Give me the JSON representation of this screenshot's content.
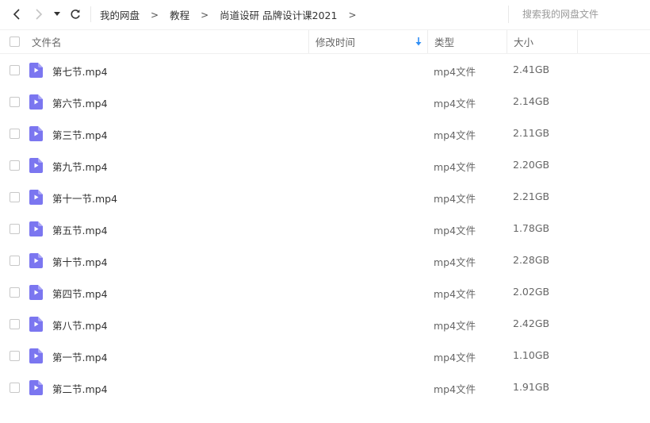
{
  "toolbar": {
    "breadcrumb": [
      "我的网盘",
      "教程",
      "尚道设研 品牌设计课2021"
    ],
    "breadcrumb_sep": ">",
    "search_placeholder": "搜索我的网盘文件"
  },
  "columns": {
    "name": "文件名",
    "modified": "修改时间",
    "type": "类型",
    "size": "大小"
  },
  "files": [
    {
      "name": "第七节.mp4",
      "type": "mp4文件",
      "size": "2.41GB"
    },
    {
      "name": "第六节.mp4",
      "type": "mp4文件",
      "size": "2.14GB"
    },
    {
      "name": "第三节.mp4",
      "type": "mp4文件",
      "size": "2.11GB"
    },
    {
      "name": "第九节.mp4",
      "type": "mp4文件",
      "size": "2.20GB"
    },
    {
      "name": "第十一节.mp4",
      "type": "mp4文件",
      "size": "2.21GB"
    },
    {
      "name": "第五节.mp4",
      "type": "mp4文件",
      "size": "1.78GB"
    },
    {
      "name": "第十节.mp4",
      "type": "mp4文件",
      "size": "2.28GB"
    },
    {
      "name": "第四节.mp4",
      "type": "mp4文件",
      "size": "2.02GB"
    },
    {
      "name": "第八节.mp4",
      "type": "mp4文件",
      "size": "2.42GB"
    },
    {
      "name": "第一节.mp4",
      "type": "mp4文件",
      "size": "1.10GB"
    },
    {
      "name": "第二节.mp4",
      "type": "mp4文件",
      "size": "1.91GB"
    }
  ],
  "icons": {
    "video_file": "video-file-icon",
    "sort": "sort-down-arrow-icon"
  },
  "colors": {
    "video_icon": "#7b76f0",
    "sort_arrow": "#2f8ef5"
  }
}
